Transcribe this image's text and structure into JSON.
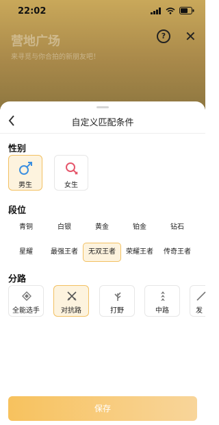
{
  "status": {
    "time": "22:02"
  },
  "background": {
    "title": "营地广场",
    "subtitle": "来寻觅与你合拍的新朋友吧！"
  },
  "sheet": {
    "title": "自定义匹配条件"
  },
  "gender": {
    "title": "性别",
    "options": [
      {
        "label": "男生",
        "selected": true,
        "color": "#3b8fe0"
      },
      {
        "label": "女生",
        "selected": false,
        "color": "#e5566b"
      }
    ]
  },
  "rank": {
    "title": "段位",
    "options": [
      {
        "label": "青铜",
        "selected": false
      },
      {
        "label": "白银",
        "selected": false
      },
      {
        "label": "黄金",
        "selected": false
      },
      {
        "label": "铂金",
        "selected": false
      },
      {
        "label": "钻石",
        "selected": false
      },
      {
        "label": "星耀",
        "selected": false
      },
      {
        "label": "最强王者",
        "selected": false
      },
      {
        "label": "无双王者",
        "selected": true
      },
      {
        "label": "荣耀王者",
        "selected": false
      },
      {
        "label": "传奇王者",
        "selected": false
      }
    ]
  },
  "lane": {
    "title": "分路",
    "options": [
      {
        "label": "全能选手",
        "selected": false,
        "icon": "all-round-icon"
      },
      {
        "label": "对抗路",
        "selected": true,
        "icon": "crossed-swords-icon"
      },
      {
        "label": "打野",
        "selected": false,
        "icon": "jungle-leaf-icon"
      },
      {
        "label": "中路",
        "selected": false,
        "icon": "mid-lane-icon"
      },
      {
        "label": "发",
        "selected": false,
        "icon": "farm-lane-icon"
      }
    ]
  },
  "actions": {
    "save_label": "保存"
  },
  "colors": {
    "accent": "#f2c061",
    "accent_bg": "#fdf3de",
    "save_start": "#f7c25e",
    "save_end": "#f8d59a"
  }
}
